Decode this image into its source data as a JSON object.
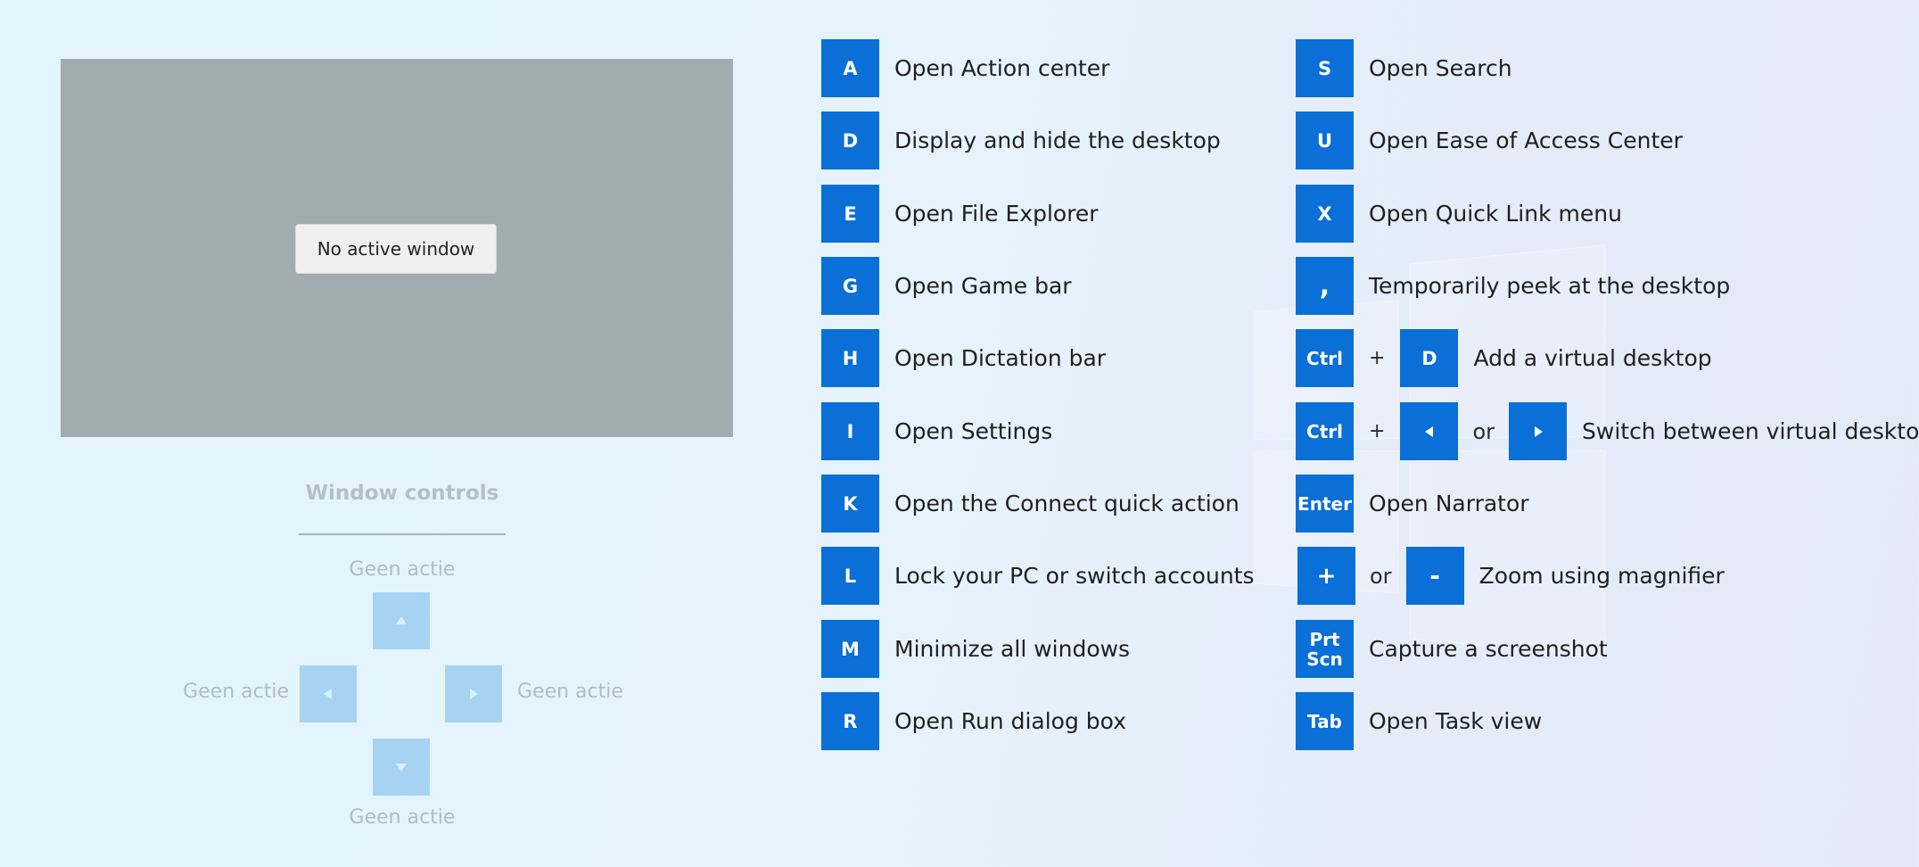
{
  "preview": {
    "no_window_label": "No active window"
  },
  "window_controls": {
    "title": "Window controls",
    "top_label": "Geen actie",
    "left_label": "Geen actie",
    "right_label": "Geen actie",
    "bottom_label": "Geen actie"
  },
  "shortcuts_left": [
    {
      "key": "A",
      "description": "Open Action center"
    },
    {
      "key": "D",
      "description": "Display and hide the desktop"
    },
    {
      "key": "E",
      "description": "Open File Explorer"
    },
    {
      "key": "G",
      "description": "Open Game bar"
    },
    {
      "key": "H",
      "description": "Open Dictation bar"
    },
    {
      "key": "I",
      "description": "Open Settings"
    },
    {
      "key": "K",
      "description": "Open the Connect quick action"
    },
    {
      "key": "L",
      "description": "Lock your PC or switch accounts"
    },
    {
      "key": "M",
      "description": "Minimize all windows"
    },
    {
      "key": "R",
      "description": "Open Run dialog box"
    }
  ],
  "shortcuts_right": {
    "search": {
      "key": "S",
      "description": "Open Search"
    },
    "ease": {
      "key": "U",
      "description": "Open Ease of Access Center"
    },
    "quicklink": {
      "key": "X",
      "description": "Open Quick Link menu"
    },
    "peek": {
      "key": ",",
      "description": "Temporarily peek at the desktop"
    },
    "add_desktop": {
      "key1": "Ctrl",
      "plus": "+",
      "key2": "D",
      "description": "Add a virtual desktop"
    },
    "switch_desktop": {
      "key1": "Ctrl",
      "plus": "+",
      "or": "or",
      "description": "Switch between virtual desktops"
    },
    "narrator": {
      "key": "Enter",
      "description": "Open Narrator"
    },
    "magnifier": {
      "key1": "+",
      "or": "or",
      "key2": "-",
      "description": "Zoom using magnifier"
    },
    "screenshot": {
      "key_line1": "Prt",
      "key_line2": "Scn",
      "description": "Capture a screenshot"
    },
    "taskview": {
      "key": "Tab",
      "description": "Open Task view"
    }
  },
  "colors": {
    "key_blue": "#0a6fd6",
    "control_blue": "#a7d3f3",
    "preview_gray": "#a0acb0"
  }
}
